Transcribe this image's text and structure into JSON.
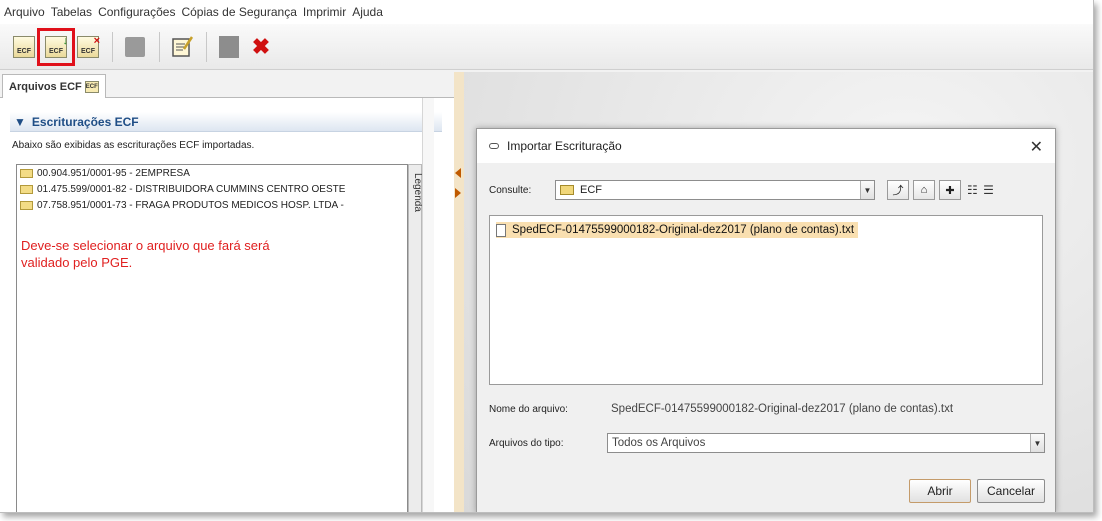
{
  "menu": [
    "Arquivo",
    "Tabelas",
    "Configurações",
    "Cópias de Segurança",
    "Imprimir",
    "Ajuda"
  ],
  "toolbar": {
    "buttons": [
      {
        "label": "ECF",
        "icon": "ecf-document-icon"
      },
      {
        "label": "ECF",
        "icon": "import-ecf-icon",
        "highlighted": true
      },
      {
        "label": "ECF",
        "icon": "delete-ecf-icon"
      },
      {
        "icon": "lock-icon"
      },
      {
        "icon": "edit-document-icon"
      },
      {
        "icon": "gray-document-icon"
      },
      {
        "icon": "close-icon"
      }
    ],
    "highlight_color": "#e0101a"
  },
  "left": {
    "tab_label": "Arquivos ECF",
    "tab_icon_text": "ECF",
    "section_title": "Escriturações ECF",
    "section_desc": "Abaixo são exibidas as escriturações ECF importadas.",
    "items": [
      "00.904.951/0001-95 - 2EMPRESA",
      "01.475.599/0001-82 - DISTRIBUIDORA CUMMINS CENTRO OESTE",
      "07.758.951/0001-73 - FRAGA PRODUTOS MEDICOS HOSP. LTDA -"
    ],
    "note_line1": "Deve-se selecionar o arquivo que fará será",
    "note_line2": "validado pelo PGE.",
    "legend": "Legenda"
  },
  "dialog": {
    "title": "Importar Escrituração",
    "lookin_label": "Consulte:",
    "lookin_value": "ECF",
    "view_icons": "☷ ☰",
    "files": [
      "SpedECF-01475599000182-Original-dez2017 (plano de contas).txt"
    ],
    "filename_label": "Nome do arquivo:",
    "filename_value": "SpedECF-01475599000182-Original-dez2017 (plano de contas).txt",
    "filetype_label": "Arquivos do tipo:",
    "filetype_value": "Todos os Arquivos",
    "open_button": "Abrir",
    "cancel_button": "Cancelar"
  }
}
